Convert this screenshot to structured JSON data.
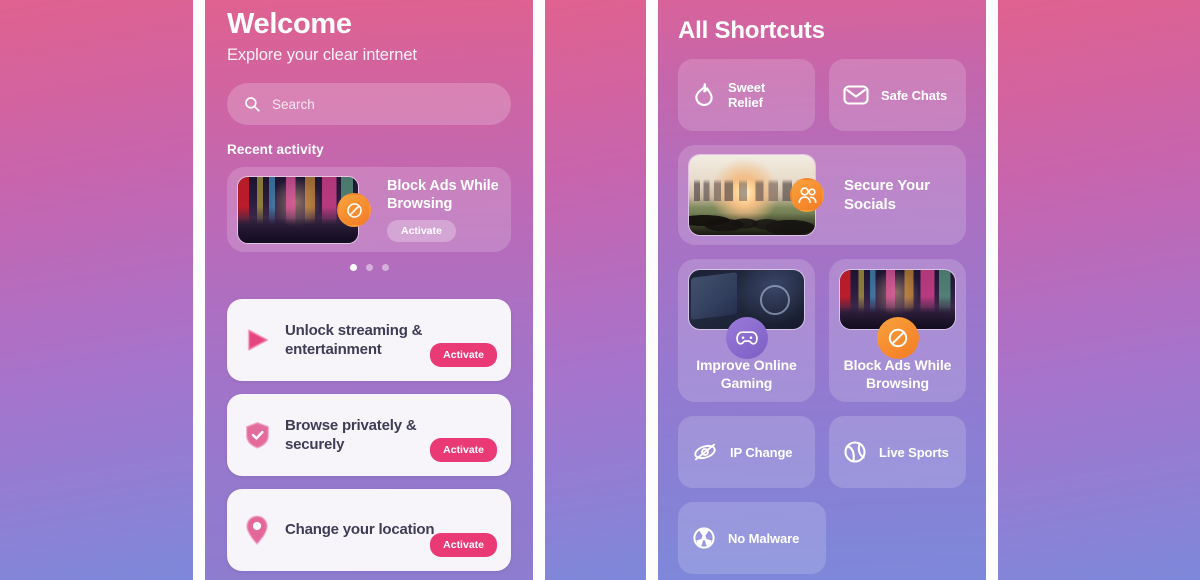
{
  "theme": {
    "accent_pink": "#ea3a75",
    "badge_orange": "#f47b25",
    "badge_purple": "#7c5ec4",
    "card_text": "#3f3d56",
    "bg_gradient_from": "#e0628f",
    "bg_gradient_to": "#7d88da"
  },
  "left_screen": {
    "title": "Welcome",
    "subtitle": "Explore your clear internet",
    "search": {
      "placeholder": "Search",
      "value": "",
      "icon": "search-icon"
    },
    "recent_label": "Recent activity",
    "recent_card": {
      "title": "Block Ads While Browsing",
      "button": "Activate",
      "badge_icon": "block-icon",
      "thumbnail": "times-square-night-photo"
    },
    "carousel": {
      "total": 3,
      "active_index": 0
    },
    "features": [
      {
        "title": "Unlock streaming & entertainment",
        "button": "Activate",
        "icon": "play-icon"
      },
      {
        "title": "Browse privately & securely",
        "button": "Activate",
        "icon": "shield-check-icon"
      },
      {
        "title": "Change your location",
        "button": "Activate",
        "icon": "location-pin-icon"
      }
    ]
  },
  "right_screen": {
    "title": "All Shortcuts",
    "top_shortcuts": [
      {
        "label": "Sweet Relief",
        "icon": "flame-icon"
      },
      {
        "label": "Safe Chats",
        "icon": "envelope-icon"
      }
    ],
    "wide_shortcut": {
      "label": "Secure Your Socials",
      "badge_icon": "users-icon",
      "thumbnail": "city-sunset-friends-photo"
    },
    "big_shortcuts": [
      {
        "label": "Improve Online Gaming",
        "badge_icon": "gamepad-icon",
        "thumbnail": "gaming-controller-photo"
      },
      {
        "label": "Block Ads While Browsing",
        "badge_icon": "block-icon",
        "thumbnail": "times-square-night-photo"
      }
    ],
    "bottom_shortcuts": [
      {
        "label": "IP Change",
        "icon": "eye-slash-orbit-icon"
      },
      {
        "label": "Live Sports",
        "icon": "tennis-ball-icon"
      },
      {
        "label": "No Malware",
        "icon": "radiation-icon"
      }
    ]
  }
}
